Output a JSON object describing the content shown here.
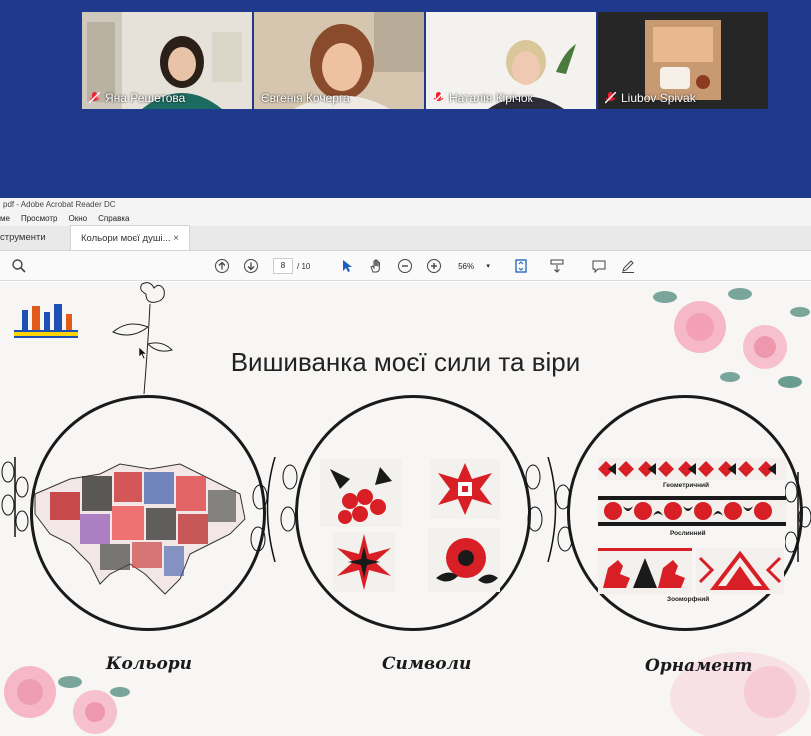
{
  "participants": [
    {
      "name": "Яна Решетова",
      "muted": true,
      "active": false,
      "bg": "#e8e4dc",
      "avatar": "participant-1-avatar"
    },
    {
      "name": "Євгенія Кочерга",
      "muted": false,
      "active": true,
      "bg": "#c9b49a",
      "avatar": "participant-2-avatar"
    },
    {
      "name": "Наталія Кірічок",
      "muted": true,
      "active": false,
      "bg": "#f0efea",
      "avatar": "participant-3-avatar"
    },
    {
      "name": "Liubov Spivak",
      "muted": true,
      "active": false,
      "bg": "#2a2a2a",
      "avatar": "participant-4-avatar"
    }
  ],
  "acrobat": {
    "title": "pdf - Adobe Acrobat Reader DC",
    "menu": [
      "ме",
      "Просмотр",
      "Окно",
      "Справка"
    ],
    "tools_tab": "струменти",
    "doc_tab": "Кольори моєї душі...",
    "page_current": "8",
    "page_total": "/ 10",
    "zoom": "56%"
  },
  "slide": {
    "title": "Вишиванка моєї сили та віри",
    "captions": [
      "Кольори",
      "Символи",
      "Орнамент"
    ],
    "ornament_labels": [
      "Геометричний",
      "Рослинний",
      "Зооморфний"
    ]
  },
  "colors": {
    "conference_bg": "#1f3a8c",
    "active_tile": "#2ee06a",
    "embroidery_red": "#d81f26",
    "embroidery_black": "#1a1a1a"
  }
}
